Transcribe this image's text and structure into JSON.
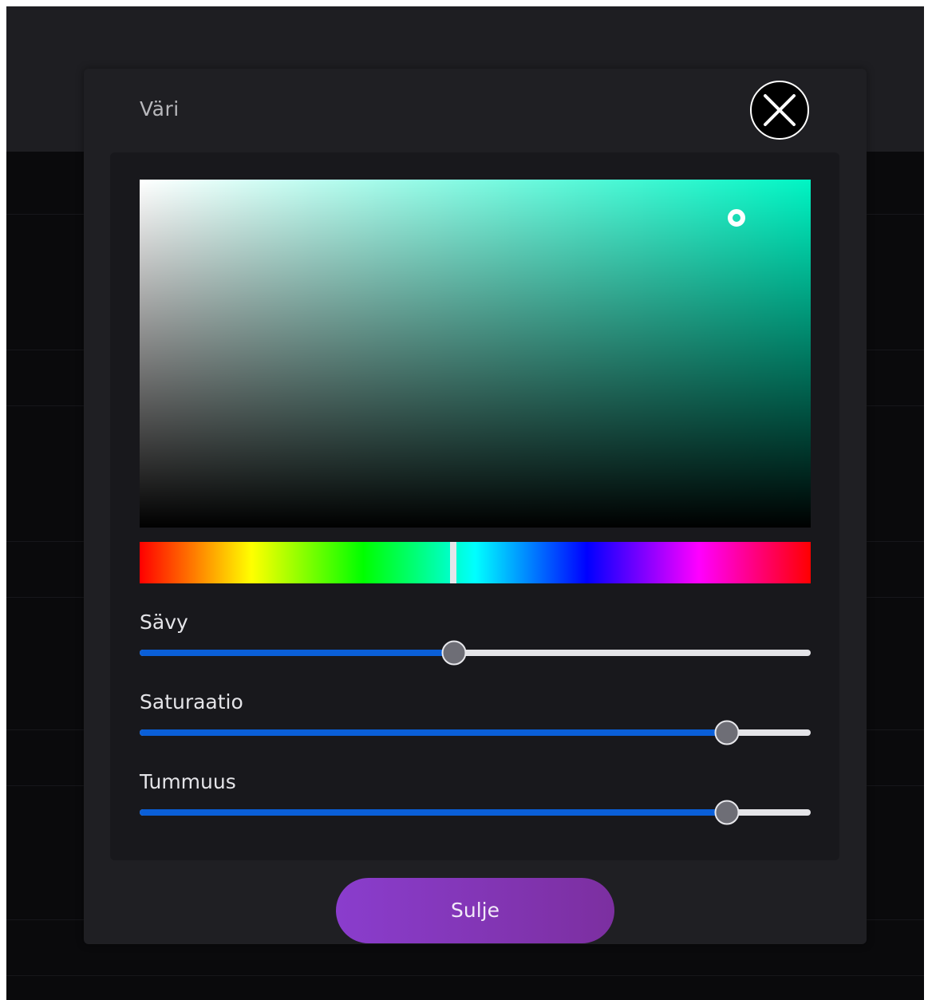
{
  "dialog": {
    "title": "Väri",
    "close_icon": "close-icon",
    "close_button_label": "Sulje"
  },
  "color_picker": {
    "hue_color": "#00f5c4",
    "saturation_value_handle": {
      "saturation": 0.89,
      "value": 0.89
    },
    "hue_fraction": 0.467
  },
  "sliders": [
    {
      "label": "Sävy",
      "value": 0.468
    },
    {
      "label": "Saturaatio",
      "value": 0.875
    },
    {
      "label": "Tummuus",
      "value": 0.875
    }
  ],
  "colors": {
    "accent_blue": "#0a5fd8",
    "button_purple": "#8a3dcd"
  }
}
